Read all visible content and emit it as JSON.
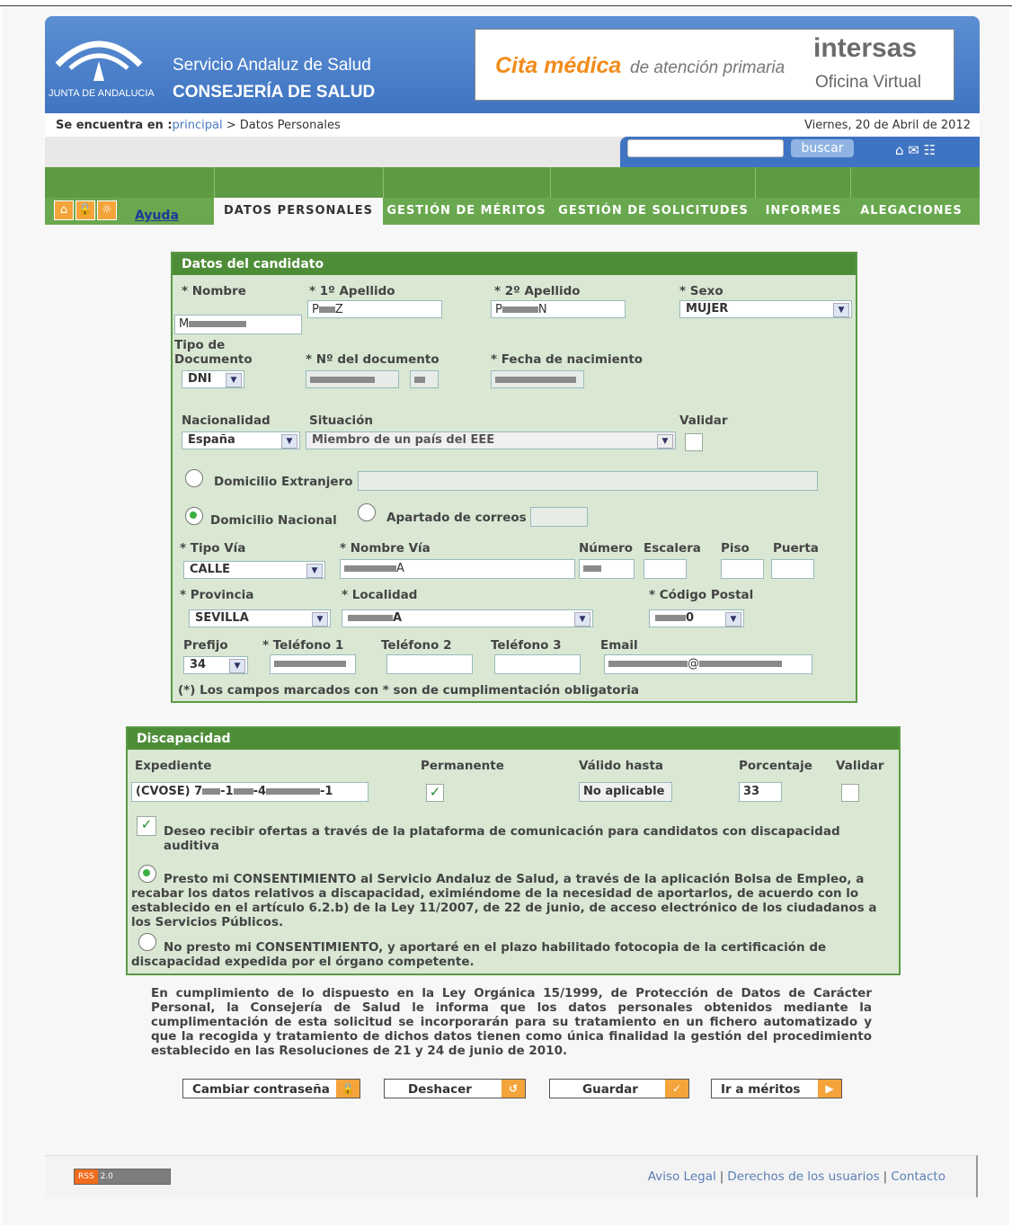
{
  "header": {
    "logo_text": "JUNTA DE ANDALUCIA",
    "org_line1": "Servicio Andaluz de Salud",
    "org_line2": "CONSEJERÍA DE SALUD",
    "banner_title": "Cita médica",
    "banner_subtitle": "de atención primaria",
    "brand": "intersas",
    "brand_subtitle": "Oficina Virtual"
  },
  "breadcrumb": {
    "prefix": "Se encuentra en :",
    "link": "principal",
    "separator": " > ",
    "current": "Datos Personales",
    "date": "Viernes, 20 de Abril de 2012"
  },
  "search": {
    "button_label": "buscar",
    "value": ""
  },
  "nav": {
    "ayuda": "Ayuda",
    "tabs": [
      "DATOS PERSONALES",
      "GESTIÓN DE MÉRITOS",
      "GESTIÓN DE SOLICITUDES",
      "INFORMES",
      "ALEGACIONES"
    ]
  },
  "candidato": {
    "title": "Datos del candidato",
    "nombre_label": "* Nombre",
    "apellido1_label": "* 1º Apellido",
    "apellido2_label": "* 2º Apellido",
    "sexo_label": "* Sexo",
    "sexo_value": "MUJER",
    "nombre_value": "M",
    "apellido1_value": "P",
    "apellido1_end": "Z",
    "apellido2_value": "P",
    "apellido2_end": "N",
    "tipo_doc_label": "Tipo de Documento",
    "tipo_doc_value": "DNI",
    "num_doc_label": "* Nº del documento",
    "fecha_nac_label": "* Fecha de nacimiento",
    "nacionalidad_label": "Nacionalidad",
    "nacionalidad_value": "España",
    "situacion_label": "Situación",
    "situacion_value": "Miembro de un país del EEE",
    "validar_label": "Validar",
    "dom_extranjero_label": "Domicilio Extranjero",
    "dom_nacional_label": "Domicilio Nacional",
    "apartado_label": "Apartado de correos",
    "tipo_via_label": "* Tipo Vía",
    "tipo_via_value": "CALLE",
    "nombre_via_label": "* Nombre Vía",
    "nombre_via_end": "A",
    "numero_label": "Número",
    "escalera_label": "Escalera",
    "piso_label": "Piso",
    "puerta_label": "Puerta",
    "provincia_label": "* Provincia",
    "provincia_value": "SEVILLA",
    "localidad_label": "* Localidad",
    "localidad_end": "A",
    "cp_label": "* Código Postal",
    "cp_end": "0",
    "prefijo_label": "Prefijo",
    "prefijo_value": "34",
    "tel1_label": "* Teléfono 1",
    "tel2_label": "Teléfono 2",
    "tel3_label": "Teléfono 3",
    "email_label": "Email",
    "note": "(*) Los campos marcados con * son de cumplimentación obligatoria"
  },
  "discapacidad": {
    "title": "Discapacidad",
    "expediente_label": "Expediente",
    "expediente_prefix": "(CVOSE) 7",
    "expediente_mid1": "-1",
    "expediente_mid2": "-4",
    "expediente_end": "-1",
    "permanente_label": "Permanente",
    "valido_label": "Válido hasta",
    "valido_value": "No aplicable",
    "porcentaje_label": "Porcentaje",
    "porcentaje_value": "33",
    "validar_label": "Validar",
    "ofertas_text": "Deseo recibir ofertas a través de la plataforma de comunicación para candidatos con discapacidad auditiva",
    "consent_yes_line1": "Presto mi CONSENTIMIENTO al Servicio Andaluz de Salud, a través de la aplicación Bolsa de Empleo, a",
    "consent_yes_rest": "recabar los datos relativos a discapacidad, eximiéndome de la necesidad de aportarlos, de acuerdo con lo establecido en el artículo 6.2.b) de la Ley 11/2007, de 22 de junio, de acceso electrónico de los ciudadanos a los Servicios Públicos.",
    "consent_no_line1": "No presto mi CONSENTIMIENTO, y aportaré en el plazo habilitado fotocopia de la certificación de",
    "consent_no_rest": "discapacidad expedida por el órgano competente."
  },
  "legal": "En cumplimiento de lo dispuesto en la Ley Orgánica 15/1999, de Protección de Datos de Carácter Personal, la Consejería de Salud le informa que los datos personales obtenidos mediante la cumplimentación de esta solicitud se incorporarán para su tratamiento en un fichero automatizado y que la recogida y tratamiento de dichos datos tienen como única finalidad la gestión del procedimiento establecido en las Resoluciones de 21 y 24 de junio de 2010.",
  "buttons": {
    "cambiar": "Cambiar contraseña",
    "deshacer": "Deshacer",
    "guardar": "Guardar",
    "meritos": "Ir a méritos"
  },
  "footer": {
    "rss": "RSS",
    "rss_version": "2.0",
    "aviso": "Aviso Legal",
    "derechos": "Derechos de los usuarios",
    "contacto": "Contacto"
  },
  "colors": {
    "header_blue": "#3f74c2",
    "nav_green": "#6aa84f",
    "panel_green": "#4e8d38",
    "panel_bg": "#d9e7d3",
    "accent_orange": "#f4a43a"
  }
}
